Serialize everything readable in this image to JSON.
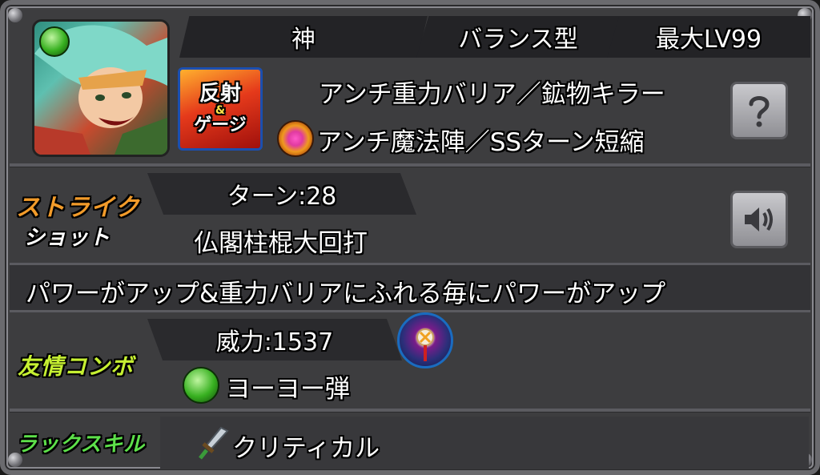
{
  "header": {
    "attribute": "神",
    "type": "バランス型",
    "max_level": "最大LV99"
  },
  "abilities": {
    "line1": "アンチ重力バリア／鉱物キラー",
    "line2": "アンチ魔法陣／SSターン短縮",
    "gauge_badge_top": "反射",
    "gauge_badge_amp": "&",
    "gauge_badge_bottom": "ゲージ"
  },
  "strike_shot": {
    "label_line1": "ストライク",
    "label_line2": "ショット",
    "turns": "ターン:28",
    "name": "仏閣柱棍大回打",
    "description": "パワーがアップ&重力バリアにふれる毎にパワーがアップ"
  },
  "friendship_combo": {
    "label": "友情コンボ",
    "power": "威力:1537",
    "name": "ヨーヨー弾"
  },
  "luck_skill": {
    "label": "ラックスキル",
    "name": "クリティカル"
  },
  "icons": {
    "help": "question-icon",
    "sound": "speaker-icon",
    "element": "wood-orb-icon",
    "ability": "ability-gem-icon",
    "combo": "yoyo-icon",
    "luck": "sword-icon"
  },
  "colors": {
    "strike_label": "#f29b2a",
    "combo_label": "#c6f032",
    "luck_label": "#5de04a"
  }
}
